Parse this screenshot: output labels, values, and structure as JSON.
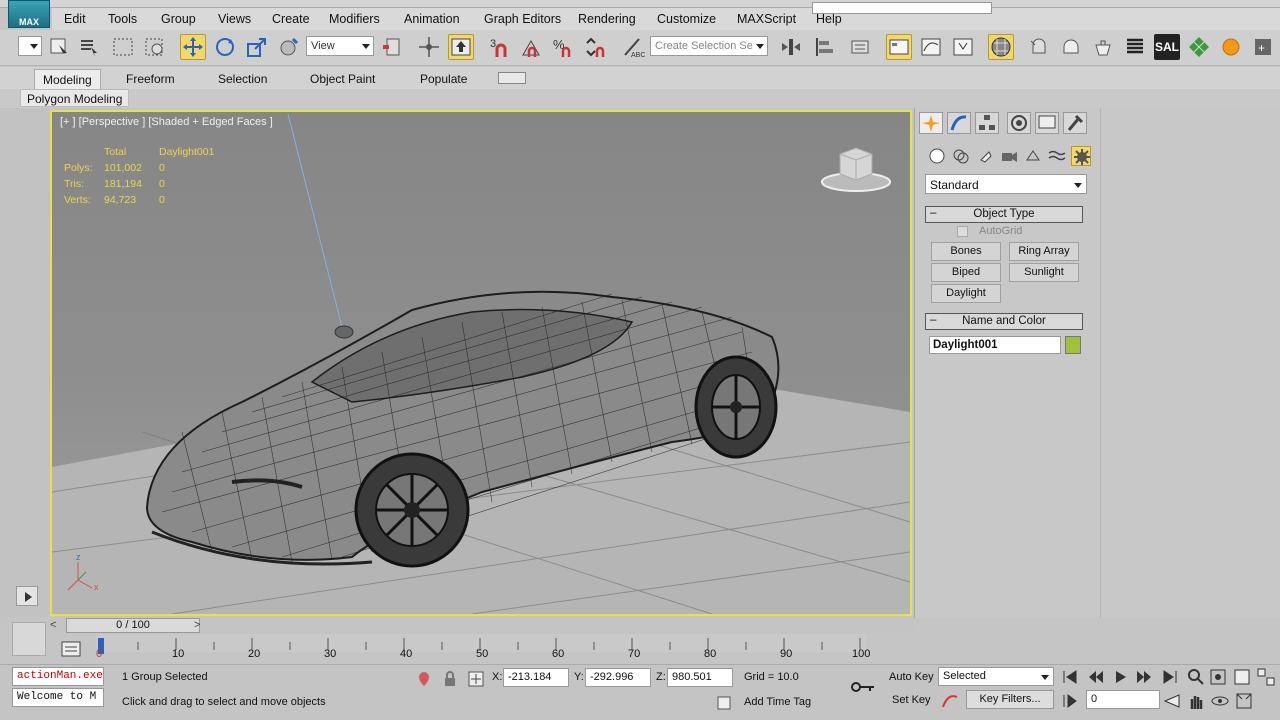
{
  "app": {
    "logo_text": "MAX"
  },
  "menu": [
    "Edit",
    "Tools",
    "Group",
    "Views",
    "Create",
    "Modifiers",
    "Animation",
    "Graph Editors",
    "Rendering",
    "Customize",
    "MAXScript",
    "Help"
  ],
  "toolbar": {
    "ref_coord": "View",
    "selection_set_placeholder": "Create Selection Se",
    "snap_label": "3",
    "sal_label": "SAL"
  },
  "ribbon": {
    "tabs": [
      "Modeling",
      "Freeform",
      "Selection",
      "Object Paint",
      "Populate"
    ],
    "active_tab": "Modeling",
    "subpanel": "Polygon Modeling"
  },
  "viewport": {
    "label": "[+ ] [Perspective ] [Shaded + Edged Faces ]",
    "stats": {
      "col_total": "Total",
      "col_object": "Daylight001",
      "rows": [
        {
          "label": "Polys:",
          "total": "101,002",
          "obj": "0"
        },
        {
          "label": "Tris:",
          "total": "181,194",
          "obj": "0"
        },
        {
          "label": "Verts:",
          "total": "94,723",
          "obj": "0"
        }
      ]
    }
  },
  "command_panel": {
    "category": "Standard",
    "object_type_title": "Object Type",
    "autogrid": "AutoGrid",
    "buttons": [
      "Bones",
      "Ring Array",
      "Biped",
      "Sunlight",
      "Daylight"
    ],
    "name_color_title": "Name and Color",
    "object_name": "Daylight001",
    "object_color": "#9fc23a"
  },
  "timeline": {
    "slider": "0 / 100",
    "ticks": [
      "0",
      "10",
      "20",
      "30",
      "40",
      "50",
      "60",
      "70",
      "80",
      "90",
      "100"
    ]
  },
  "status": {
    "script_listener": "actionMan.exe",
    "welcome": "Welcome to M",
    "selection": "1 Group Selected",
    "prompt": "Click and drag to select and move objects",
    "x_label": "X:",
    "x_value": "-213.184",
    "y_label": "Y:",
    "y_value": "-292.996",
    "z_label": "Z:",
    "z_value": "980.501",
    "grid": "Grid = 10.0",
    "add_time_tag": "Add Time Tag",
    "auto_key": "Auto Key",
    "set_key": "Set Key",
    "key_mode": "Selected",
    "key_filters": "Key Filters...",
    "frame": "0"
  },
  "colors": {
    "viewport_border": "#e8e24a",
    "stats_text": "#e7d84a",
    "active_tool": "#f2d86a"
  }
}
